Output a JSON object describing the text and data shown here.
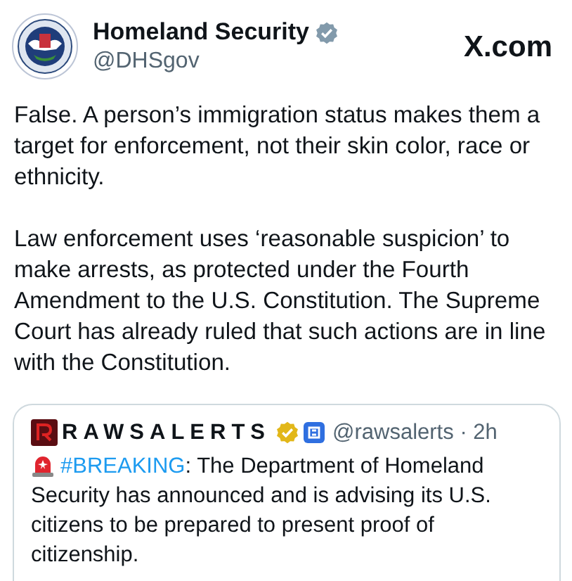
{
  "author": {
    "name": "Homeland Security",
    "verified": true,
    "handle": "@DHSgov"
  },
  "site": "X.com",
  "paragraphs": [
    "False. A person’s immigration status makes them a target for enforcement, not their skin color, race or ethnicity.",
    "Law enforcement uses ‘reasonable suspicion’ to make arrests, as protected under the Fourth Amendment to the U.S. Constitution. The Supreme Court has already ruled that such actions are in line with the Constitution."
  ],
  "quoted": {
    "name": "RAWSALERTS",
    "verified": true,
    "handle": "@rawsalerts",
    "separator": "·",
    "time": "2h",
    "hashtag": "#BREAKING",
    "text": ": The Department of Homeland Security has announced and is advising its U.S. citizens to be prepared to present proof of citizenship."
  }
}
